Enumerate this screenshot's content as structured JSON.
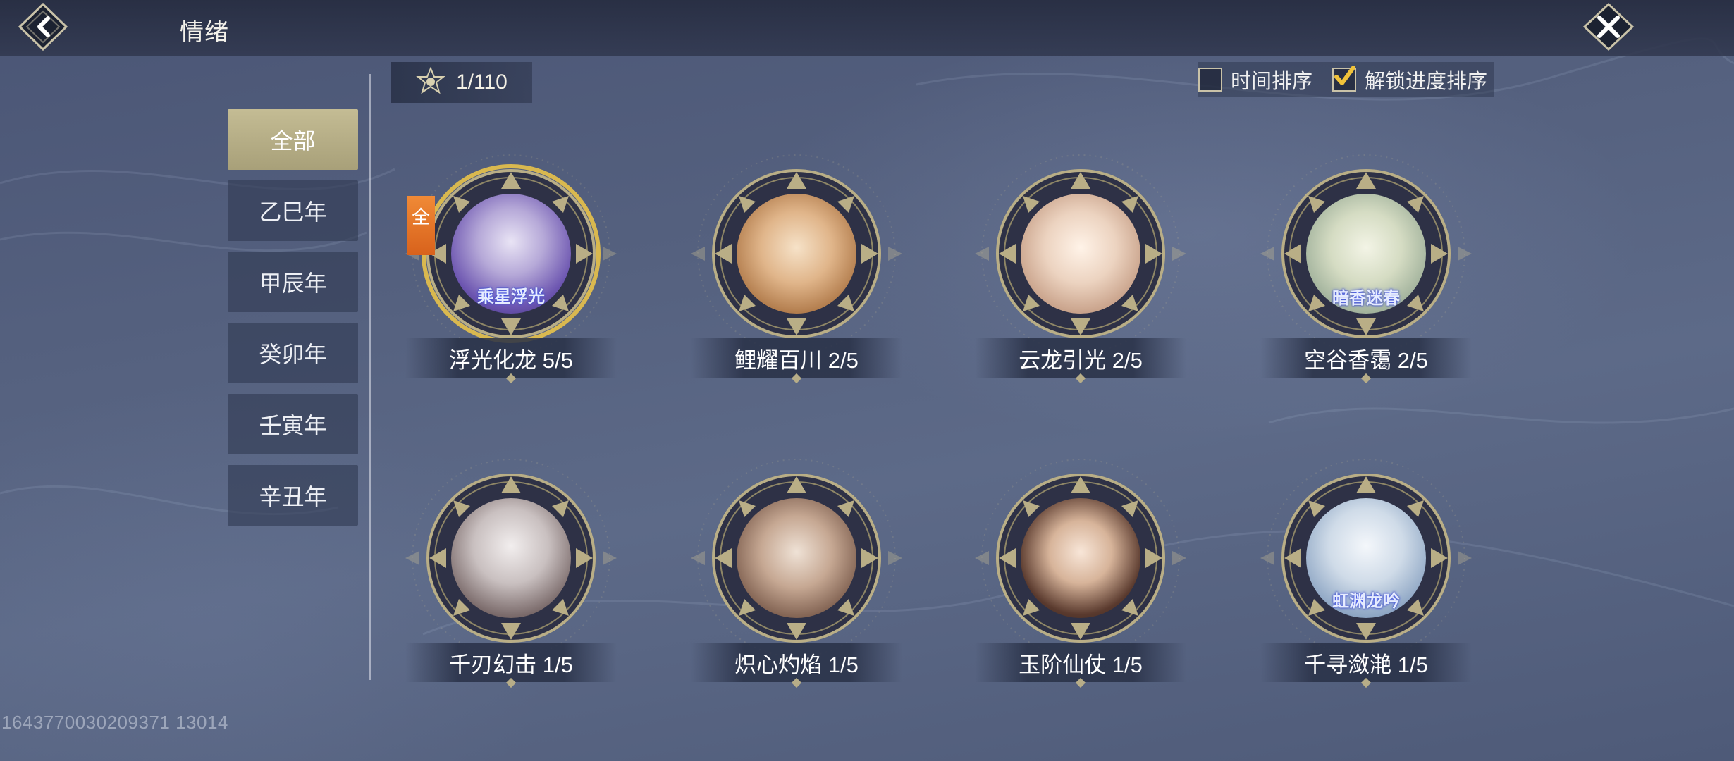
{
  "header": {
    "title": "情绪"
  },
  "counter": {
    "text": "1/110"
  },
  "sort": {
    "time_label": "时间排序",
    "time_checked": false,
    "unlock_label": "解锁进度排序",
    "unlock_checked": true
  },
  "tabs": [
    {
      "label": "全部",
      "active": true
    },
    {
      "label": "乙巳年"
    },
    {
      "label": "甲辰年"
    },
    {
      "label": "癸卯年"
    },
    {
      "label": "壬寅年"
    },
    {
      "label": "辛丑年"
    }
  ],
  "items": [
    {
      "name": "浮光化龙 5/5",
      "badge": "全",
      "caption": "乘星浮光"
    },
    {
      "name": "鲤耀百川 2/5"
    },
    {
      "name": "云龙引光 2/5"
    },
    {
      "name": "空谷香霭 2/5",
      "caption": "暗香迷春"
    },
    {
      "name": "千刃幻击 1/5"
    },
    {
      "name": "炽心灼焰 1/5"
    },
    {
      "name": "玉阶仙仗 1/5"
    },
    {
      "name": "千寻潋滟 1/5",
      "caption": "虹渊龙吟"
    }
  ],
  "footer": {
    "uid": "1643770030209371 13014"
  },
  "colors": {
    "accent_gold": "#c4bc94",
    "badge_orange": "#e8772a",
    "panel": "#303a52"
  }
}
